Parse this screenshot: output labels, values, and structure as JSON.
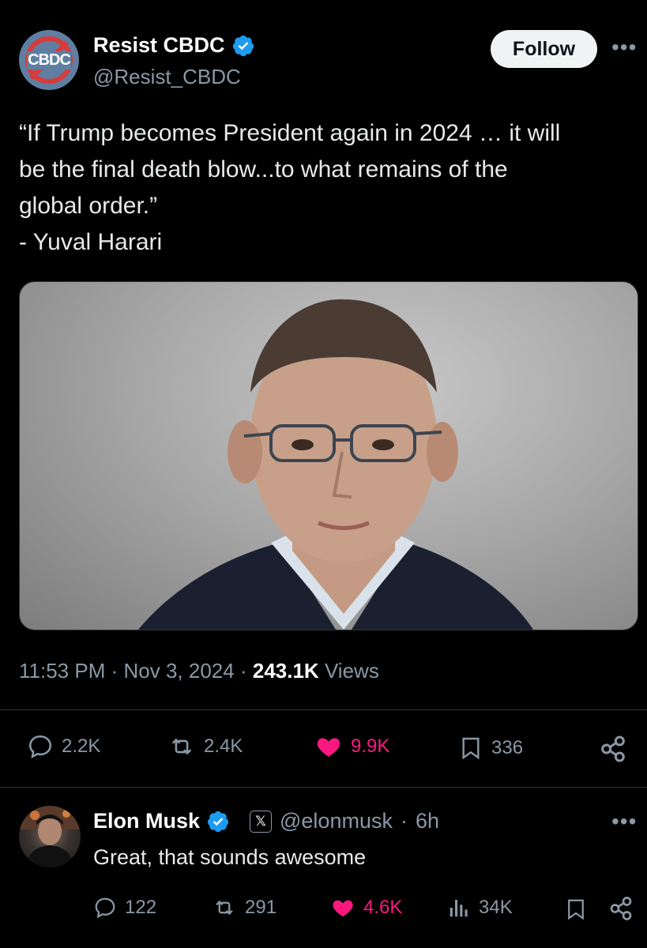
{
  "tweet": {
    "author": {
      "avatar_text": "CBDC",
      "name": "Resist CBDC",
      "handle": "@Resist_CBDC"
    },
    "follow_label": "Follow",
    "more_label": "•••",
    "text": "“If Trump becomes President again in 2024 … it will\nbe the final death blow...to what remains of the\nglobal order.”\n- Yuval Harari",
    "time": "11:53 PM",
    "date": "Nov 3, 2024",
    "views_count": "243.1K",
    "views_label": "Views",
    "separator": "·",
    "stats": {
      "replies": "2.2K",
      "retweets": "2.4K",
      "likes": "9.9K",
      "bookmarks": "336"
    }
  },
  "reply": {
    "name": "Elon Musk",
    "badge": "𝕏",
    "handle": "@elonmusk",
    "separator": "·",
    "age": "6h",
    "more_label": "•••",
    "text": "Great, that sounds awesome",
    "stats": {
      "replies": "122",
      "retweets": "291",
      "likes": "4.6K",
      "views": "34K"
    }
  },
  "colors": {
    "background": "#000000",
    "verified": "#1d9bf0",
    "like": "#f91880",
    "muted": "#8b98a5"
  }
}
